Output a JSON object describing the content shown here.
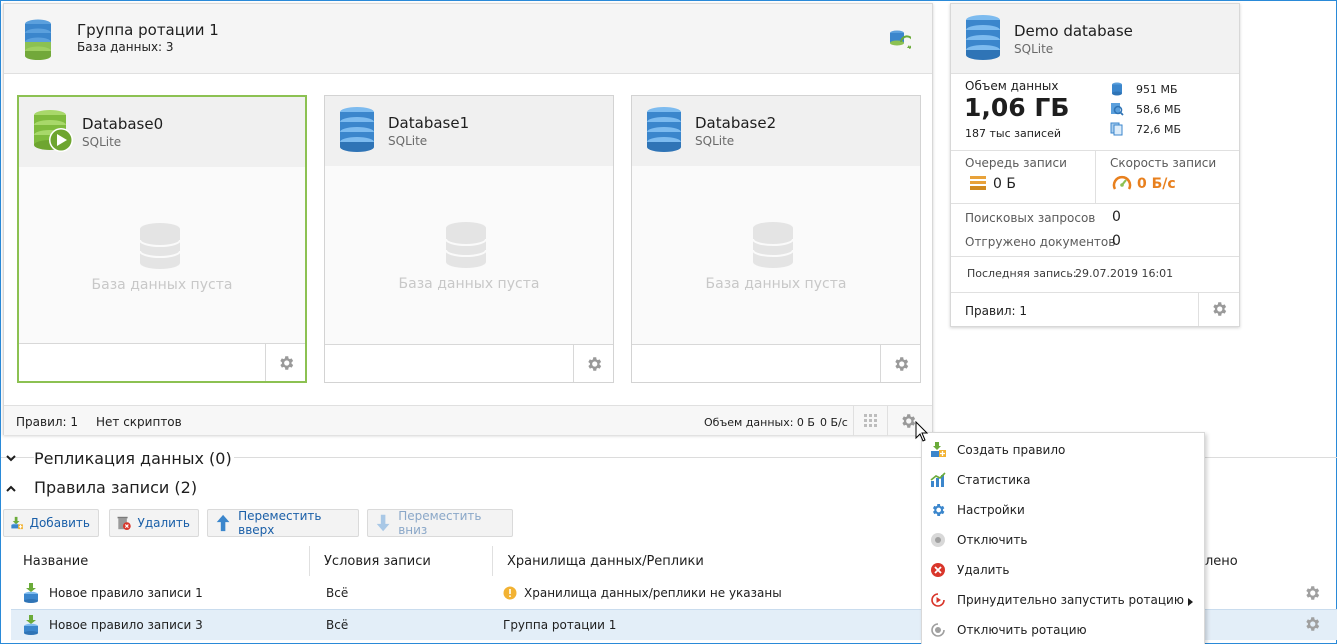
{
  "group": {
    "title": "Группа ротации 1",
    "subtitle": "База данных: 3",
    "databases": [
      {
        "name": "Database0",
        "type": "SQLite",
        "empty_text": "База данных пуста",
        "active": true
      },
      {
        "name": "Database1",
        "type": "SQLite",
        "empty_text": "База данных пуста",
        "active": false
      },
      {
        "name": "Database2",
        "type": "SQLite",
        "empty_text": "База данных пуста",
        "active": false
      }
    ],
    "footer": {
      "rules": "Правил: 1",
      "scripts": "Нет скриптов",
      "data_volume": "Объем данных: 0 Б",
      "speed": "0 Б/с"
    }
  },
  "demo": {
    "title": "Demo database",
    "type": "SQLite",
    "volume_label": "Объем данных",
    "volume_value": "1,06 ГБ",
    "records": "187 тыс записей",
    "sizes": [
      "951 МБ",
      "58,6 МБ",
      "72,6 МБ"
    ],
    "queue_label": "Очередь записи",
    "queue_value": "0 Б",
    "speed_label": "Скорость записи",
    "speed_value": "0 Б/с",
    "search_label": "Поисковых запросов",
    "search_value": "0",
    "shipped_label": "Отгружено документов",
    "shipped_value": "0",
    "last_write_label": "Последняя запись:",
    "last_write_value": "29.07.2019 16:01",
    "rules": "Правил: 1"
  },
  "sections": {
    "replication": "Репликация данных (0)",
    "write_rules": "Правила записи (2)"
  },
  "toolbar": {
    "add": "Добавить",
    "delete": "Удалить",
    "move_up": "Переместить вверх",
    "move_down": "Переместить вниз"
  },
  "table": {
    "headers": [
      "Название",
      "Условия записи",
      "Хранилища данных/Реплики",
      "лено"
    ],
    "rows": [
      {
        "name": "Новое правило записи 1",
        "conditions": "Всё",
        "storage": "Хранилища данных/реплики не указаны",
        "warning": true
      },
      {
        "name": "Новое правило записи 3",
        "conditions": "Всё",
        "storage": "Группа ротации 1",
        "warning": false
      }
    ]
  },
  "menu": {
    "items": [
      {
        "label": "Создать правило",
        "icon": "create-rule-icon"
      },
      {
        "label": "Статистика",
        "icon": "statistics-icon"
      },
      {
        "label": "Настройки",
        "icon": "settings-icon"
      },
      {
        "label": "Отключить",
        "icon": "disable-icon"
      },
      {
        "label": "Удалить",
        "icon": "delete-icon"
      },
      {
        "label": "Принудительно запустить ротацию",
        "icon": "force-rotation-icon",
        "submenu": true
      },
      {
        "label": "Отключить ротацию",
        "icon": "disable-rotation-icon"
      }
    ]
  },
  "colors": {
    "accent_green": "#8cc152",
    "link_blue": "#1a5fa8",
    "speed_orange": "#e8801e",
    "delete_red": "#d9362b"
  }
}
